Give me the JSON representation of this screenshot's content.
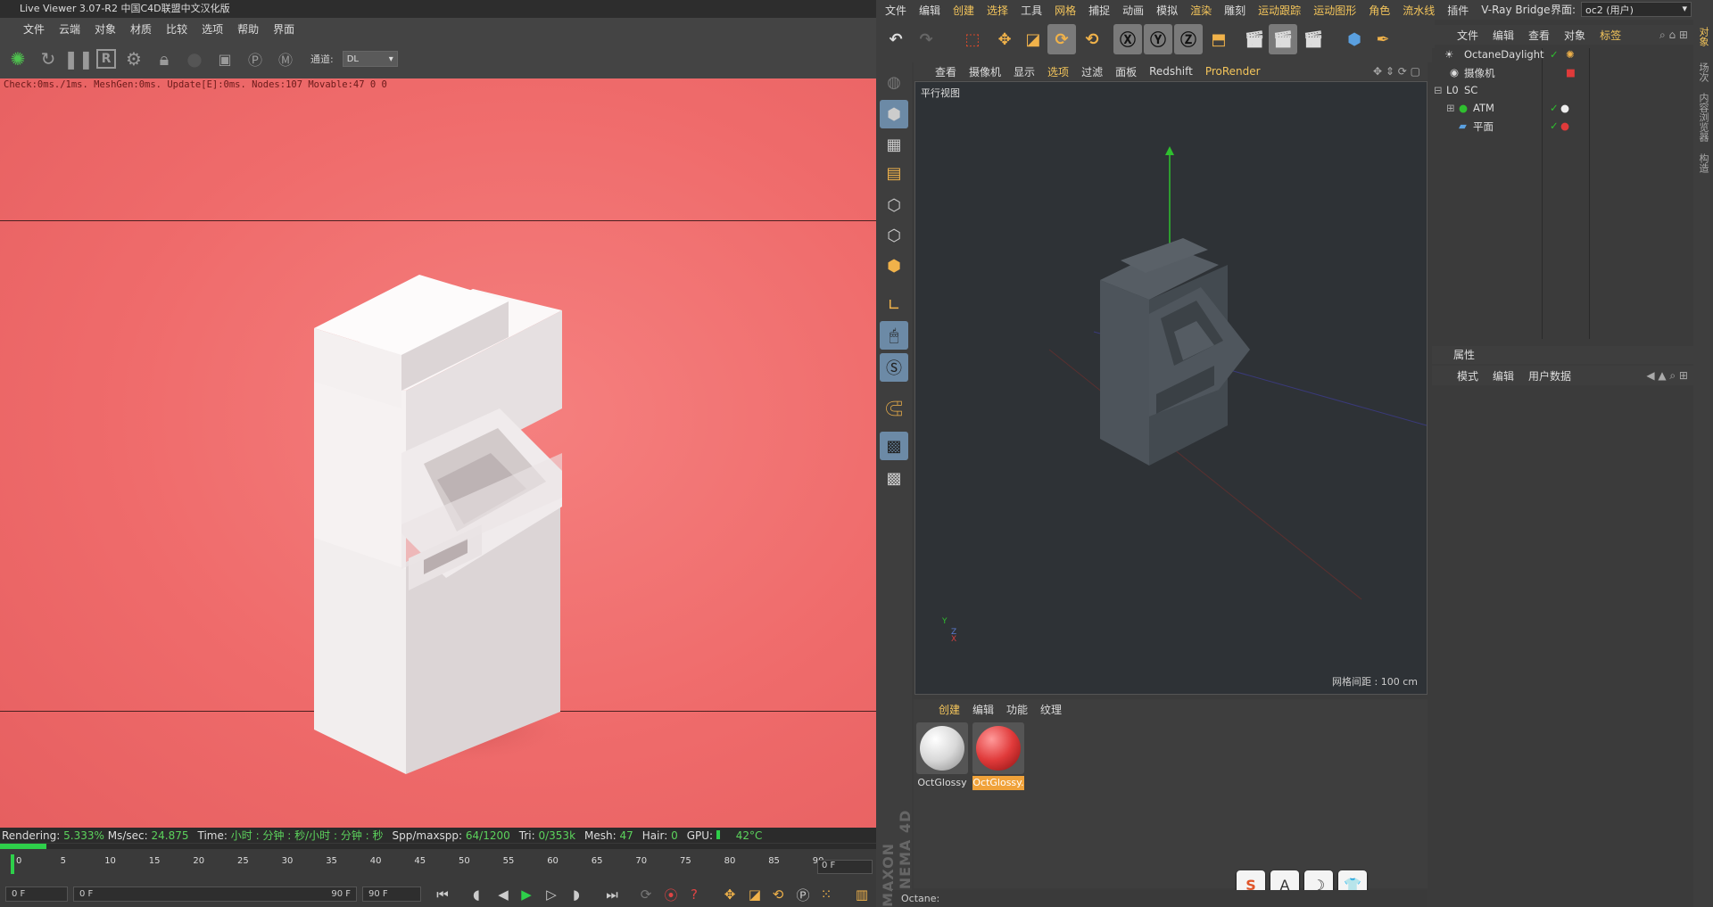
{
  "live_viewer": {
    "title": "Live Viewer 3.07-R2 中国C4D联盟中文汉化版",
    "menu": [
      "文件",
      "云端",
      "对象",
      "材质",
      "比较",
      "选项",
      "帮助",
      "界面"
    ],
    "channel_label": "通道:",
    "channel_value": "DL",
    "render_info": "Check:0ms./1ms. MeshGen:0ms. Update[E]:0ms. Nodes:107 Movable:47  0 0",
    "status": {
      "rendering_label": "Rendering:",
      "rendering_value": "5.333%",
      "ms_label": "Ms/sec:",
      "ms_value": "24.875",
      "time_label": "Time:",
      "time_value": "小时 : 分钟 : 秒/小时 : 分钟 : 秒",
      "spp_label": "Spp/maxspp:",
      "spp_value": "64/1200",
      "tri_label": "Tri:",
      "tri_value": "0/353k",
      "mesh_label": "Mesh:",
      "mesh_value": "47",
      "hair_label": "Hair:",
      "hair_value": "0",
      "gpu_label": "GPU:",
      "gpu_value": "42°C"
    },
    "progress": 0.0533
  },
  "timeline": {
    "ticks": [
      "0",
      "5",
      "10",
      "15",
      "20",
      "25",
      "30",
      "35",
      "40",
      "45",
      "50",
      "55",
      "60",
      "65",
      "70",
      "75",
      "80",
      "85",
      "90"
    ],
    "current_frame_field": "0 F",
    "start_field": "0 F",
    "range_start": "0 F",
    "range_end": "90 F",
    "end_field": "90 F"
  },
  "c4d": {
    "menu": [
      "文件",
      "编辑",
      "创建",
      "选择",
      "工具",
      "网格",
      "捕捉",
      "动画",
      "模拟",
      "渲染",
      "雕刻",
      "运动跟踪",
      "运动图形",
      "角色",
      "流水线",
      "插件",
      "V-Ray Bridge"
    ],
    "menu_highlight": [
      "创建",
      "选择",
      "网格",
      "渲染",
      "运动跟踪",
      "运动图形",
      "角色",
      "流水线"
    ],
    "layout_label": "界面:",
    "layout_value": "oc2 (用户)",
    "viewport_menu": [
      "查看",
      "摄像机",
      "显示",
      "选项",
      "过滤",
      "面板",
      "Redshift",
      "ProRender"
    ],
    "viewport_label": "平行视图",
    "grid_spacing": "网格间距 : 100 cm",
    "material_menu": [
      "创建",
      "编辑",
      "功能",
      "纹理"
    ],
    "materials": [
      {
        "name": "OctGlossy",
        "color": "#e8e8e8",
        "selected": false
      },
      {
        "name": "OctGlossy.",
        "color": "#e03a3a",
        "selected": true
      }
    ],
    "status_bar": "Octane:",
    "brand": "MAXON CINEMA 4D",
    "object_menu": [
      "文件",
      "编辑",
      "查看",
      "对象",
      "标签"
    ],
    "objects": [
      {
        "name": "OctaneDaylight",
        "indent": 0
      },
      {
        "name": "摄像机",
        "indent": 0
      },
      {
        "name": "SC",
        "indent": 0
      },
      {
        "name": "ATM",
        "indent": 1
      },
      {
        "name": "平面",
        "indent": 1
      }
    ],
    "attributes_title": "属性",
    "attributes_menu": [
      "模式",
      "编辑",
      "用户数据"
    ],
    "side_tabs": [
      "对象",
      "场次",
      "内容浏览器",
      "构造"
    ],
    "ime_buttons": [
      "S",
      "A",
      "☽",
      "👕"
    ]
  },
  "colors": {
    "render_bg": "#ef6b6b",
    "accent": "#f4c55b",
    "progress": "#2ecf4a"
  }
}
